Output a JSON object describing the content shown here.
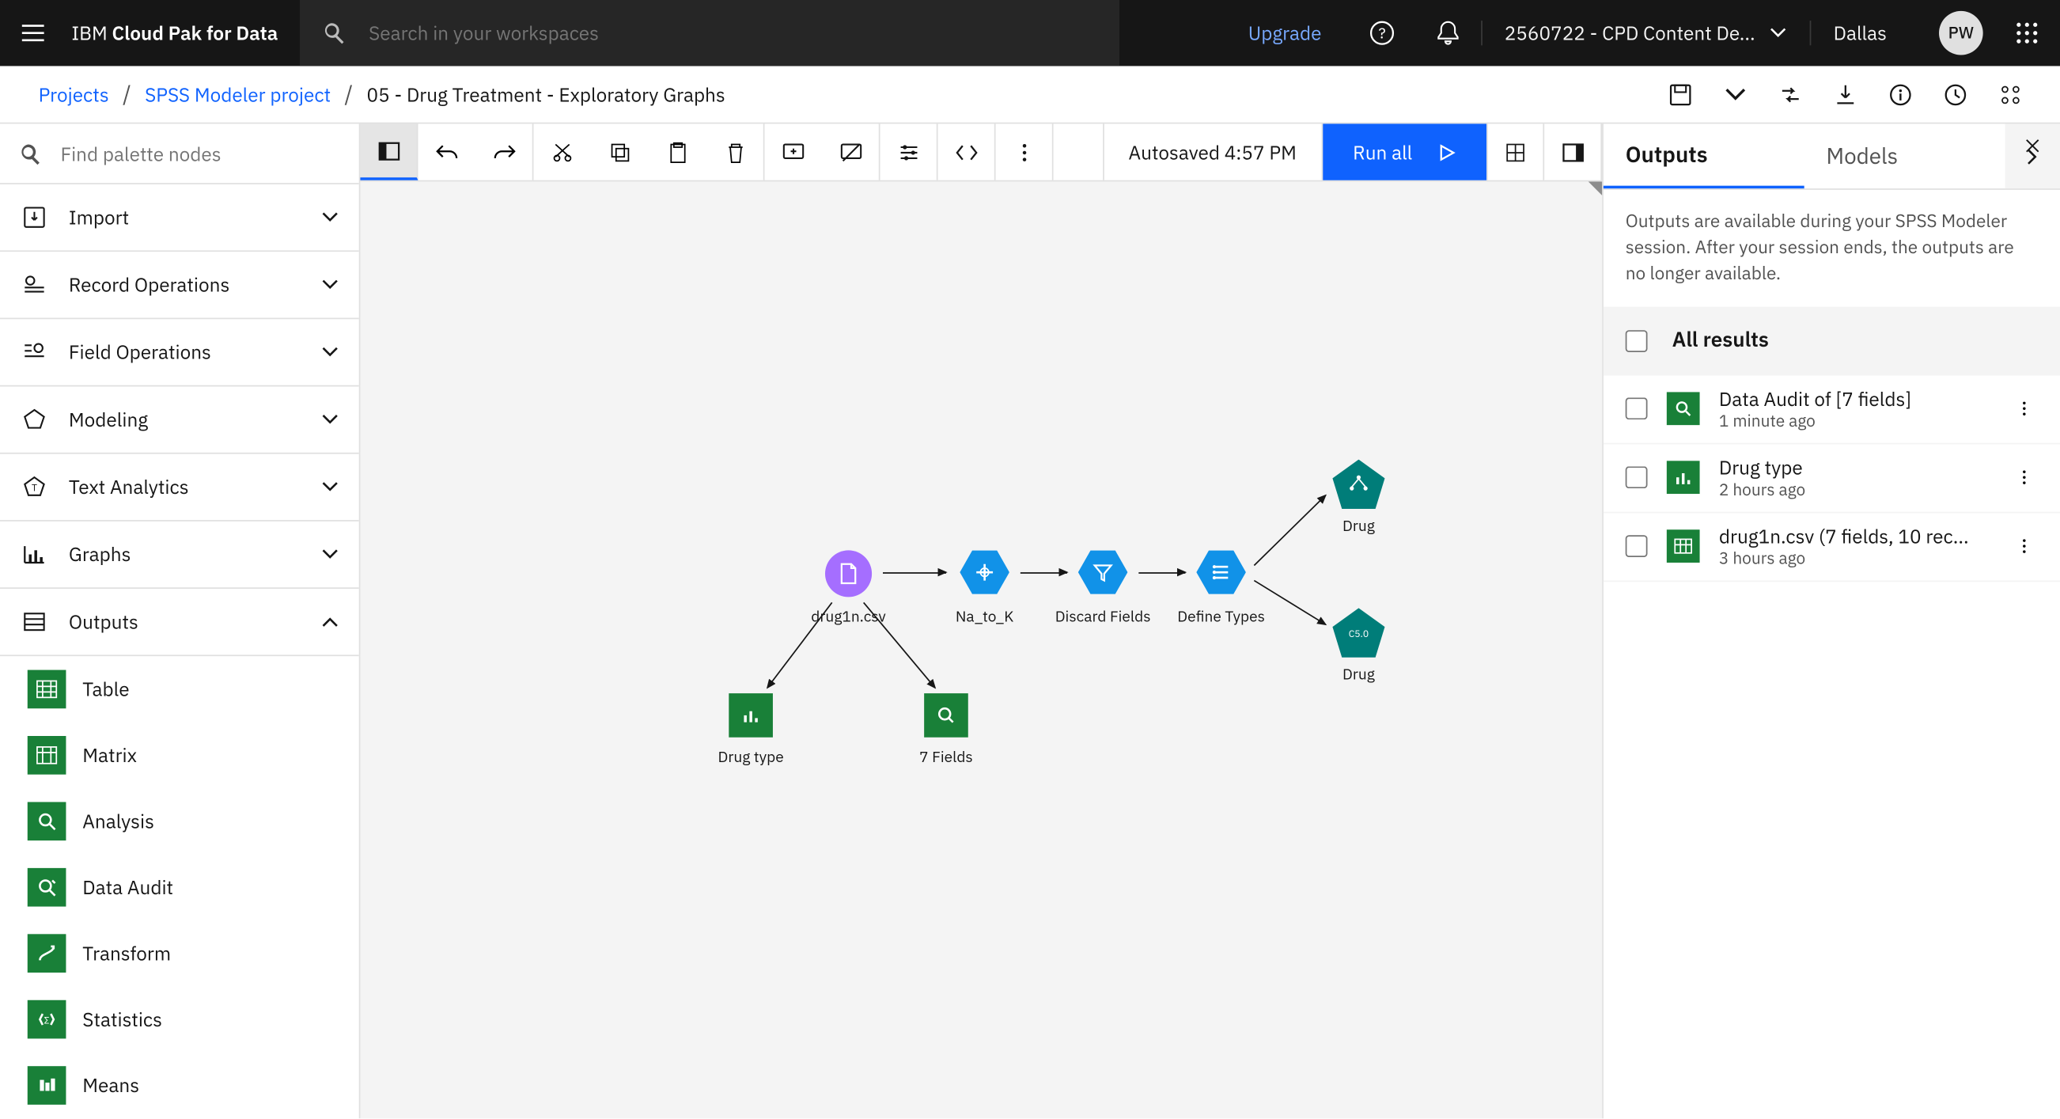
{
  "header": {
    "brand_prefix": "IBM ",
    "brand_bold": "Cloud Pak for Data",
    "search_placeholder": "Search in your workspaces",
    "upgrade": "Upgrade",
    "account": "2560722 - CPD Content De...",
    "region": "Dallas",
    "avatar": "PW"
  },
  "breadcrumb": {
    "projects": "Projects",
    "project": "SPSS Modeler project",
    "current": "05 - Drug Treatment - Exploratory Graphs"
  },
  "palette": {
    "search_placeholder": "Find palette nodes",
    "cats": {
      "import": "Import",
      "record": "Record Operations",
      "field": "Field Operations",
      "modeling": "Modeling",
      "text": "Text Analytics",
      "graphs": "Graphs",
      "outputs": "Outputs"
    },
    "output_items": {
      "table": "Table",
      "matrix": "Matrix",
      "analysis": "Analysis",
      "audit": "Data Audit",
      "transform": "Transform",
      "statistics": "Statistics",
      "means": "Means"
    }
  },
  "toolbar": {
    "autosave": "Autosaved 4:57 PM",
    "run_all": "Run all"
  },
  "canvas": {
    "n1": "drug1n.csv",
    "n2": "Na_to_K",
    "n3": "Discard Fields",
    "n4": "Define Types",
    "n5": "Drug",
    "n6": "Drug",
    "n7": "Drug type",
    "n8": "7 Fields"
  },
  "outputs": {
    "tab_outputs": "Outputs",
    "tab_models": "Models",
    "note": "Outputs are available during your SPSS Modeler session. After your session ends, the outputs are no longer available.",
    "all_results": "All results",
    "items": [
      {
        "title": "Data Audit of [7 fields]",
        "time": "1 minute ago",
        "icon": "audit"
      },
      {
        "title": "Drug type",
        "time": "2 hours ago",
        "icon": "chart"
      },
      {
        "title": "drug1n.csv (7 fields, 10 rec...",
        "time": "3 hours ago",
        "icon": "table"
      }
    ]
  }
}
